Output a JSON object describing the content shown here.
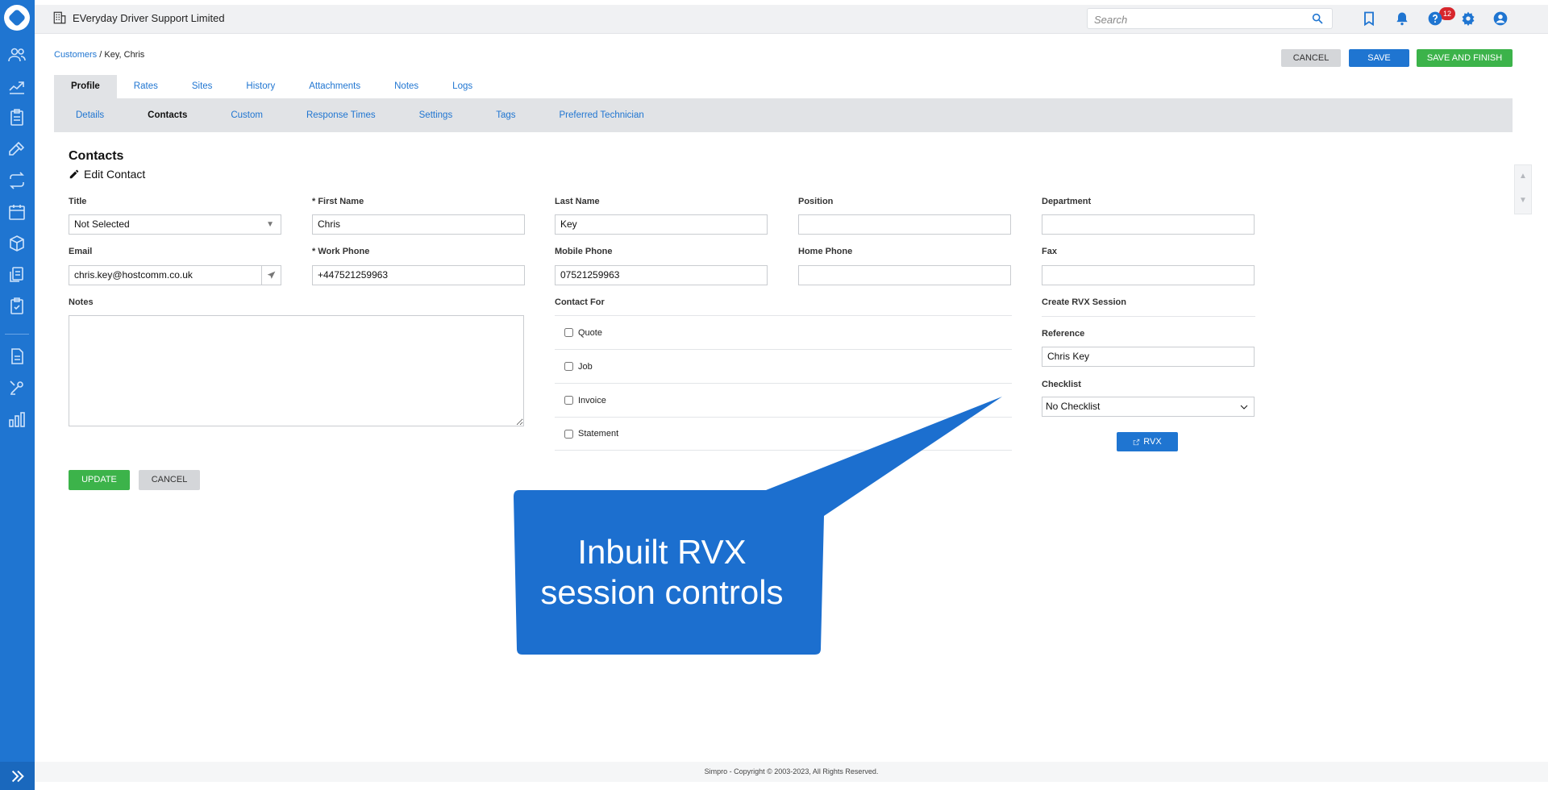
{
  "topbar": {
    "company_name": "EVeryday Driver Support Limited",
    "search_placeholder": "Search",
    "notification_count": "12"
  },
  "breadcrumb": {
    "parent": "Customers",
    "separator": "/",
    "current": "Key, Chris"
  },
  "actions": {
    "cancel": "CANCEL",
    "save": "SAVE",
    "save_and_finish": "SAVE AND FINISH"
  },
  "tabs": [
    {
      "label": "Profile"
    },
    {
      "label": "Rates"
    },
    {
      "label": "Sites"
    },
    {
      "label": "History"
    },
    {
      "label": "Attachments"
    },
    {
      "label": "Notes"
    },
    {
      "label": "Logs"
    }
  ],
  "subtabs": [
    {
      "label": "Details"
    },
    {
      "label": "Contacts"
    },
    {
      "label": "Custom"
    },
    {
      "label": "Response Times"
    },
    {
      "label": "Settings"
    },
    {
      "label": "Tags"
    },
    {
      "label": "Preferred Technician"
    }
  ],
  "contact": {
    "section_title": "Contacts",
    "edit_title": "Edit Contact",
    "title_label": "Title",
    "title_value": "Not Selected",
    "first_name_label": "* First Name",
    "first_name_value": "Chris",
    "last_name_label": "Last Name",
    "last_name_value": "Key",
    "position_label": "Position",
    "position_value": "",
    "department_label": "Department",
    "department_value": "",
    "email_label": "Email",
    "email_value": "chris.key@hostcomm.co.uk",
    "work_phone_label": "* Work Phone",
    "work_phone_value": "+447521259963",
    "mobile_phone_label": "Mobile Phone",
    "mobile_phone_value": "07521259963",
    "home_phone_label": "Home Phone",
    "home_phone_value": "",
    "fax_label": "Fax",
    "fax_value": "",
    "notes_label": "Notes",
    "notes_value": "",
    "contact_for_label": "Contact For",
    "contact_for_options": [
      {
        "label": "Quote"
      },
      {
        "label": "Job"
      },
      {
        "label": "Invoice"
      },
      {
        "label": "Statement"
      }
    ],
    "rvx_section_label": "Create RVX Session",
    "reference_label": "Reference",
    "reference_value": "Chris Key",
    "checklist_label": "Checklist",
    "checklist_value": "No Checklist",
    "rvx_button": "RVX",
    "update_button": "UPDATE",
    "cancel_button": "CANCEL"
  },
  "callout": {
    "line1": "Inbuilt RVX",
    "line2": "session controls",
    "color": "#1c6fcf"
  },
  "footer": {
    "copyright": "Simpro - Copyright © 2003-2023, All Rights Reserved."
  },
  "colors": {
    "brand_blue": "#1f75d1",
    "save_green": "#3cb34a",
    "badge_red": "#d7262c"
  }
}
